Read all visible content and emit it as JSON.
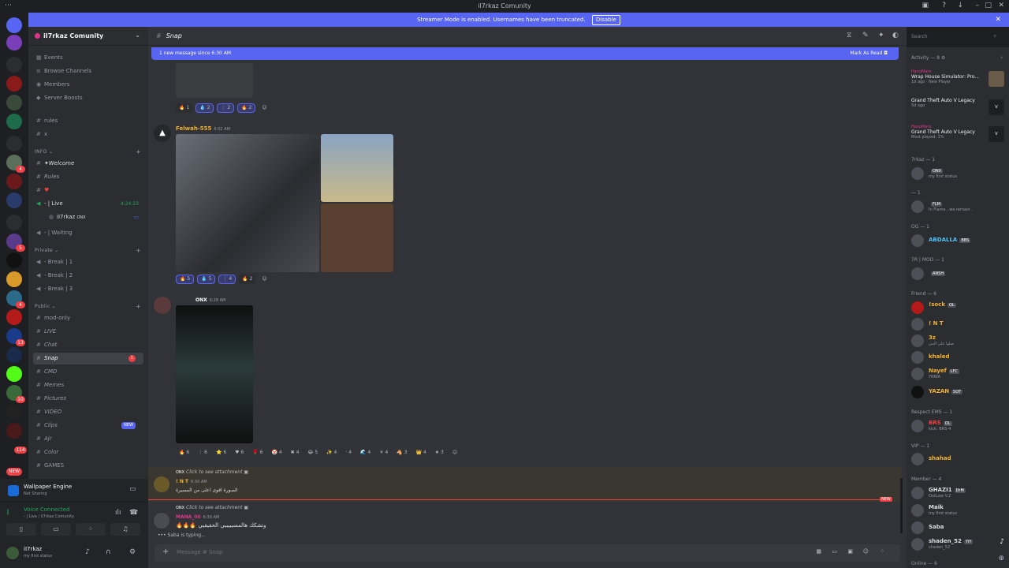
{
  "window": {
    "title": "iI7rkaz Comunity"
  },
  "banner": {
    "text": "Streamer Mode is enabled. Usernames have been truncated.",
    "disable_label": "Disable"
  },
  "rail": {
    "badges": [
      "4",
      "5",
      "4",
      "13",
      "10",
      "114"
    ],
    "new_label": "NEW"
  },
  "server": {
    "name": "iI7rkaz Comunity"
  },
  "nav": [
    {
      "icon": "calendar-icon",
      "label": "Events"
    },
    {
      "icon": "browse-icon",
      "label": "Browse Channels"
    },
    {
      "icon": "members-icon",
      "label": "Members"
    },
    {
      "icon": "boost-icon",
      "label": "Server Boosts"
    }
  ],
  "channels_top": [
    "rules",
    "x"
  ],
  "categories": {
    "info": "INFO",
    "private": "Private",
    "public": "Public"
  },
  "info_channels": [
    "✦Welcome",
    "Rules",
    ""
  ],
  "voice_live": {
    "name": "- | Live",
    "time": "4:24:23",
    "user": "iI7rkaz",
    "user_tag": "ONX"
  },
  "voice_waiting": "- | Waiting",
  "private_channels": [
    "- Break | 1",
    "- Break | 2",
    "- Break | 3"
  ],
  "public_channels": [
    "mod-only",
    "LIVE",
    "Chat",
    "Snap",
    "CMD",
    "Memes",
    "Pictures",
    "VIDEO",
    "Clips",
    "Ajr",
    "Color",
    "GAMES"
  ],
  "snap_unread": "1",
  "clips_badge": "NEW",
  "activity_panel": {
    "title": "Wallpaper Engine",
    "status": "Not Sharing"
  },
  "voice_panel": {
    "status": "Voice Connected",
    "channel": "- | Live / iI7rkaz Comunity"
  },
  "user_panel": {
    "name": "iI7rkaz",
    "status": "my first status"
  },
  "channel": {
    "name": "Snap",
    "search_placeholder": "Search",
    "new_message_bar": "1 new message since 6:30 AM",
    "mark_read": "Mark As Read"
  },
  "messages": {
    "m1_reactions": [
      "🔥 1",
      "💧 2",
      "⋮ 2",
      "🔥 2"
    ],
    "m2": {
      "author": "Felwah-555",
      "time": "6:02 AM",
      "reactions": [
        "🔥 5",
        "💧 5",
        "⋮ 4",
        "🔥 2"
      ]
    },
    "m3": {
      "tag": "ONX",
      "time": "6:28 AM",
      "reactions": [
        "🔥 6",
        "⋮ 6",
        "⭐ 6",
        "♥ 6",
        "🌹 6",
        "🤡 4",
        "✖ 4",
        "😂 5",
        "✨ 4",
        "· 4",
        "🌊 4",
        "☀ 4",
        "🐴 3",
        "👑 4",
        "★ 3"
      ]
    },
    "r1": {
      "replied_tag": "ONX",
      "replied_text": "Click to see attachment",
      "author": "! N T",
      "time": "6:30 AM",
      "text": "الصورة اقوى اعلى من المسيرة"
    },
    "r2": {
      "replied_tag": "ONX",
      "replied_text": "Click to see attachment",
      "author": "MANA_00",
      "time": "6:30 AM",
      "text": "🔥🔥🔥 وتشكك هالمسيبيبيي الحقيقيي"
    },
    "new_label": "NEW"
  },
  "typing": "Saba is typing...",
  "composer_placeholder": "Message # Snap",
  "members": {
    "activity_header": "Activity — 8",
    "activity": [
      {
        "name": "HanoMaro",
        "game": "Wrap House Simulator: Pro...",
        "sub": "1d ago · New Player"
      },
      {
        "name": "",
        "game": "Grand Theft Auto V Legacy",
        "sub": "5d ago"
      },
      {
        "name": "HanoMaro",
        "game": "Grand Theft Auto V Legacy",
        "sub": "Most played: 1%"
      }
    ],
    "groups": [
      {
        "label": "7rkaz — 1",
        "members": [
          {
            "name": "",
            "tag": "ONX",
            "status": "my first status",
            "color": "#ffffff"
          }
        ]
      },
      {
        "label": "— 1",
        "members": [
          {
            "name": "",
            "tag": "FLM",
            "status": "In Flame , we remain .",
            "color": "#ffffff"
          }
        ]
      },
      {
        "label": "OG — 1",
        "members": [
          {
            "name": "ABDALLA",
            "tag": "BBS",
            "status": "",
            "color": "#4fc3f7"
          }
        ]
      },
      {
        "label": "7R | MOD — 1",
        "members": [
          {
            "name": "",
            "tag": "ANSH",
            "status": "",
            "color": "#ffffff"
          }
        ]
      },
      {
        "label": "Friend — 6",
        "members": [
          {
            "name": "!sock",
            "tag": "OL",
            "status": "",
            "color": "#f0b232"
          },
          {
            "name": "! N T",
            "tag": "",
            "status": "",
            "color": "#f0b232"
          },
          {
            "name": "3z",
            "tag": "",
            "status": "صلوا على النبي",
            "color": "#f0b232"
          },
          {
            "name": "khaled",
            "tag": "",
            "status": "",
            "color": "#f0b232"
          },
          {
            "name": "Nayef",
            "tag": "LFC",
            "status": "YNWA",
            "color": "#f0b232"
          },
          {
            "name": "YAZAN",
            "tag": "SOT",
            "status": "",
            "color": "#f0b232"
          }
        ]
      },
      {
        "label": "Respect EMS — 1",
        "members": [
          {
            "name": "BRS",
            "tag": "OL",
            "status": "kick: BRS-4",
            "color": "#f23f43"
          }
        ]
      },
      {
        "label": "VIP — 1",
        "members": [
          {
            "name": "shahad",
            "tag": "",
            "status": "",
            "color": "#f0b232"
          }
        ]
      },
      {
        "label": "Member — 4",
        "members": [
          {
            "name": "GHAZI1",
            "tag": "DrM",
            "status": "OutLaw V.2",
            "color": "#dbdee1"
          },
          {
            "name": "Maik",
            "tag": "",
            "status": "my first status",
            "color": "#dbdee1"
          },
          {
            "name": "Saba",
            "tag": "",
            "status": "",
            "color": "#dbdee1"
          },
          {
            "name": "shaden_52",
            "tag": "YIY",
            "status": "shaden_52",
            "color": "#dbdee1"
          }
        ]
      },
      {
        "label": "Online — 6",
        "members": []
      }
    ]
  }
}
